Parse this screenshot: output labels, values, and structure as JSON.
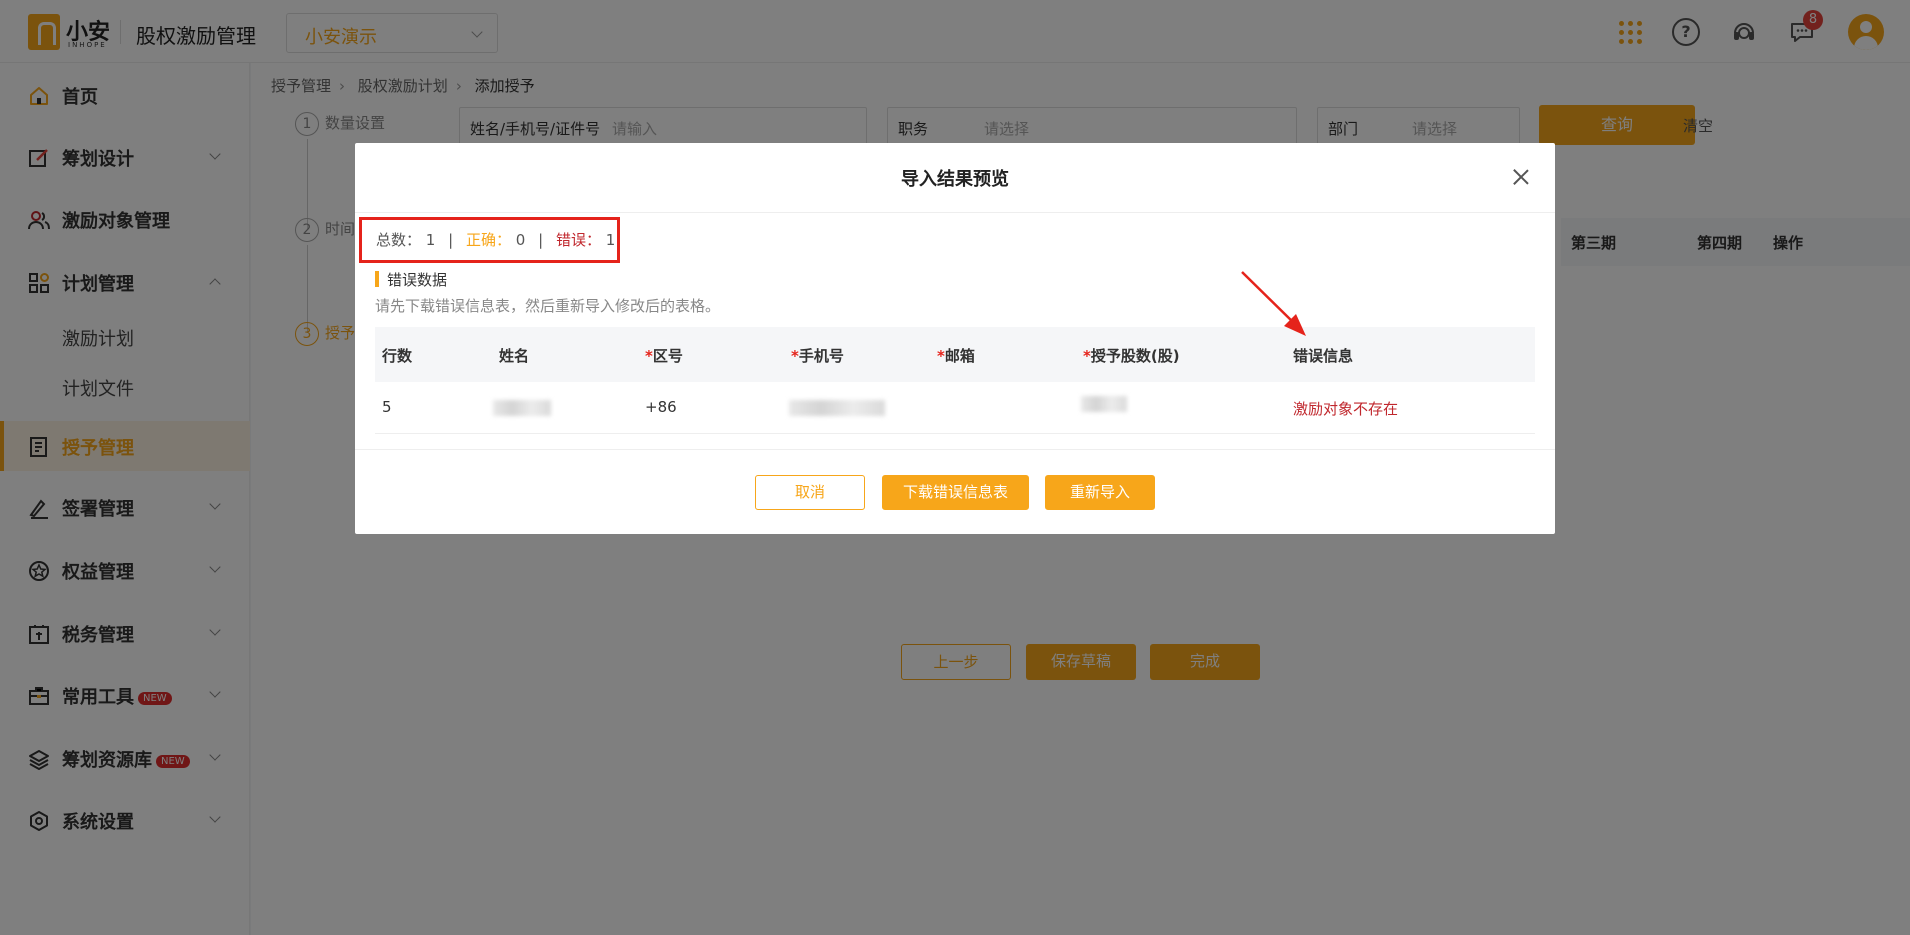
{
  "header": {
    "logo_text": "小安",
    "logo_sub": "INHOPE",
    "app_title": "股权激励管理",
    "company": "小安演示",
    "message_count": "8",
    "help_glyph": "?"
  },
  "sidebar": {
    "items": [
      {
        "label": "首页",
        "icon": "home-icon"
      },
      {
        "label": "筹划设计",
        "icon": "edit-icon"
      },
      {
        "label": "激励对象管理",
        "icon": "users-icon"
      },
      {
        "label": "计划管理",
        "icon": "apps-icon"
      },
      {
        "label": "授予管理",
        "icon": "book-icon"
      },
      {
        "label": "签署管理",
        "icon": "sign-icon"
      },
      {
        "label": "权益管理",
        "icon": "equity-icon"
      },
      {
        "label": "税务管理",
        "icon": "tax-icon"
      },
      {
        "label": "常用工具",
        "icon": "toolbox-icon"
      },
      {
        "label": "筹划资源库",
        "icon": "layers-icon"
      },
      {
        "label": "系统设置",
        "icon": "settings-icon"
      }
    ],
    "sub_items": [
      "激励计划",
      "计划文件"
    ],
    "new_badge": "NEW"
  },
  "page": {
    "breadcrumb": [
      "授予管理",
      "股权激励计划",
      "添加授予"
    ],
    "steps": [
      {
        "num": "1",
        "label": "数量设置"
      },
      {
        "num": "2",
        "label": "时间"
      },
      {
        "num": "3",
        "label": "授予"
      }
    ],
    "filters": {
      "name_label": "姓名/手机号/证件号",
      "name_placeholder": "请输入",
      "position_label": "职务",
      "position_placeholder": "请选择",
      "dept_label": "部门",
      "dept_placeholder": "请选择",
      "query": "查询",
      "clear": "清空"
    },
    "table_headers": [
      "第三期",
      "第四期",
      "操作"
    ],
    "buttons": {
      "prev": "上一步",
      "save_draft": "保存草稿",
      "finish": "完成"
    }
  },
  "modal": {
    "title": "导入结果预览",
    "summary": {
      "total_label": "总数：",
      "total": "1",
      "correct_label": "正确：",
      "correct": "0",
      "error_label": "错误：",
      "error": "1",
      "separator": "|"
    },
    "section_title": "错误数据",
    "section_hint": "请先下载错误信息表，然后重新导入修改后的表格。",
    "columns": [
      "行数",
      "姓名",
      "区号",
      "手机号",
      "邮箱",
      "授予股数(股)",
      "错误信息"
    ],
    "required_mark": "*",
    "rows": [
      {
        "row": "5",
        "area_code": "+86",
        "error": "激励对象不存在"
      }
    ],
    "buttons": {
      "cancel": "取消",
      "download": "下载错误信息表",
      "reimport": "重新导入"
    }
  },
  "colors": {
    "accent": "#f7a61a",
    "error": "#c0272d",
    "highlight_box": "#e5231b"
  }
}
